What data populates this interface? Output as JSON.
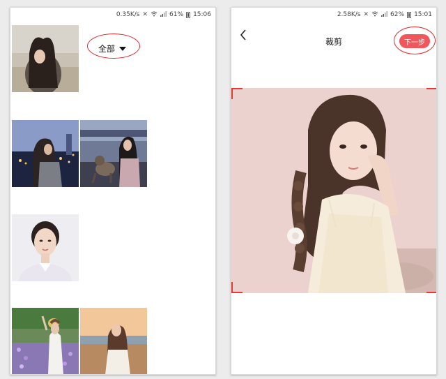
{
  "left_screen": {
    "status": {
      "speed": "0.35K/s",
      "battery": "61%",
      "time": "15:06"
    },
    "album_selector": "全部",
    "thumbnails": [
      {
        "name": "photo-girl-beach"
      },
      {
        "name": "photo-girl-city-night"
      },
      {
        "name": "photo-girl-with-dog"
      },
      {
        "name": "photo-id-portrait"
      },
      {
        "name": "photo-girl-flower-field"
      },
      {
        "name": "photo-girl-seaside-sunset"
      }
    ]
  },
  "right_screen": {
    "status": {
      "speed": "2.58K/s",
      "battery": "62%",
      "time": "15:01"
    },
    "title": "裁剪",
    "next_button": "下一步",
    "crop_image": "portrait-girl-braid",
    "accent_color": "#f0565b",
    "crop_corner_color": "#e53935"
  },
  "annotation_color": "#e02a2a"
}
